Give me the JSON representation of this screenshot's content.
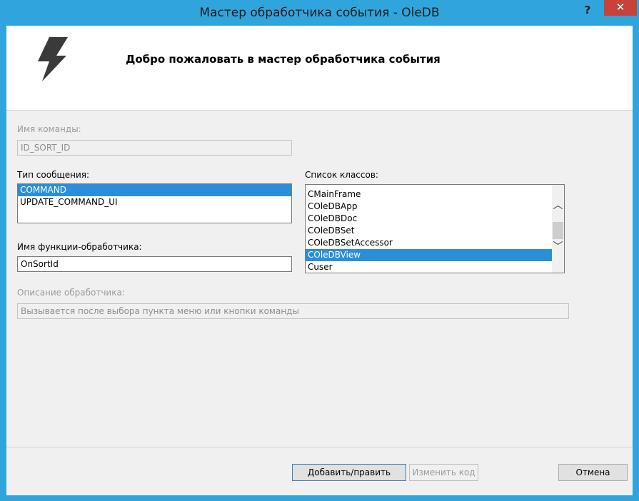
{
  "window": {
    "title": "Мастер обработчика события - OleDB",
    "help_label": "?",
    "close_label": "✕"
  },
  "banner": {
    "title": "Добро пожаловать в мастер обработчика события",
    "icon": "lightning-bolt-icon"
  },
  "form": {
    "command_name_label": "Имя команды:",
    "command_name_value": "ID_SORT_ID",
    "message_type_label": "Тип сообщения:",
    "message_types": [
      "COMMAND",
      "UPDATE_COMMAND_UI"
    ],
    "selected_message_type": "COMMAND",
    "class_list_label": "Список классов:",
    "classes": [
      "CMainFrame",
      "COleDBApp",
      "COleDBDoc",
      "COleDBSet",
      "COleDBSetAccessor",
      "COleDBView",
      "Cuser"
    ],
    "selected_class": "COleDBView",
    "handler_name_label": "Имя функции-обработчика:",
    "handler_name_value": "OnSortId",
    "description_label": "Описание обработчика:",
    "description_value": "Вызывается после выбора пункта меню или кнопки команды"
  },
  "buttons": {
    "add_edit": "Добавить/править",
    "edit_code": "Изменить код",
    "cancel": "Отмена"
  },
  "colors": {
    "titlebar": "#2fa4dd",
    "close": "#c7423a",
    "selection": "#2a8fd8"
  }
}
